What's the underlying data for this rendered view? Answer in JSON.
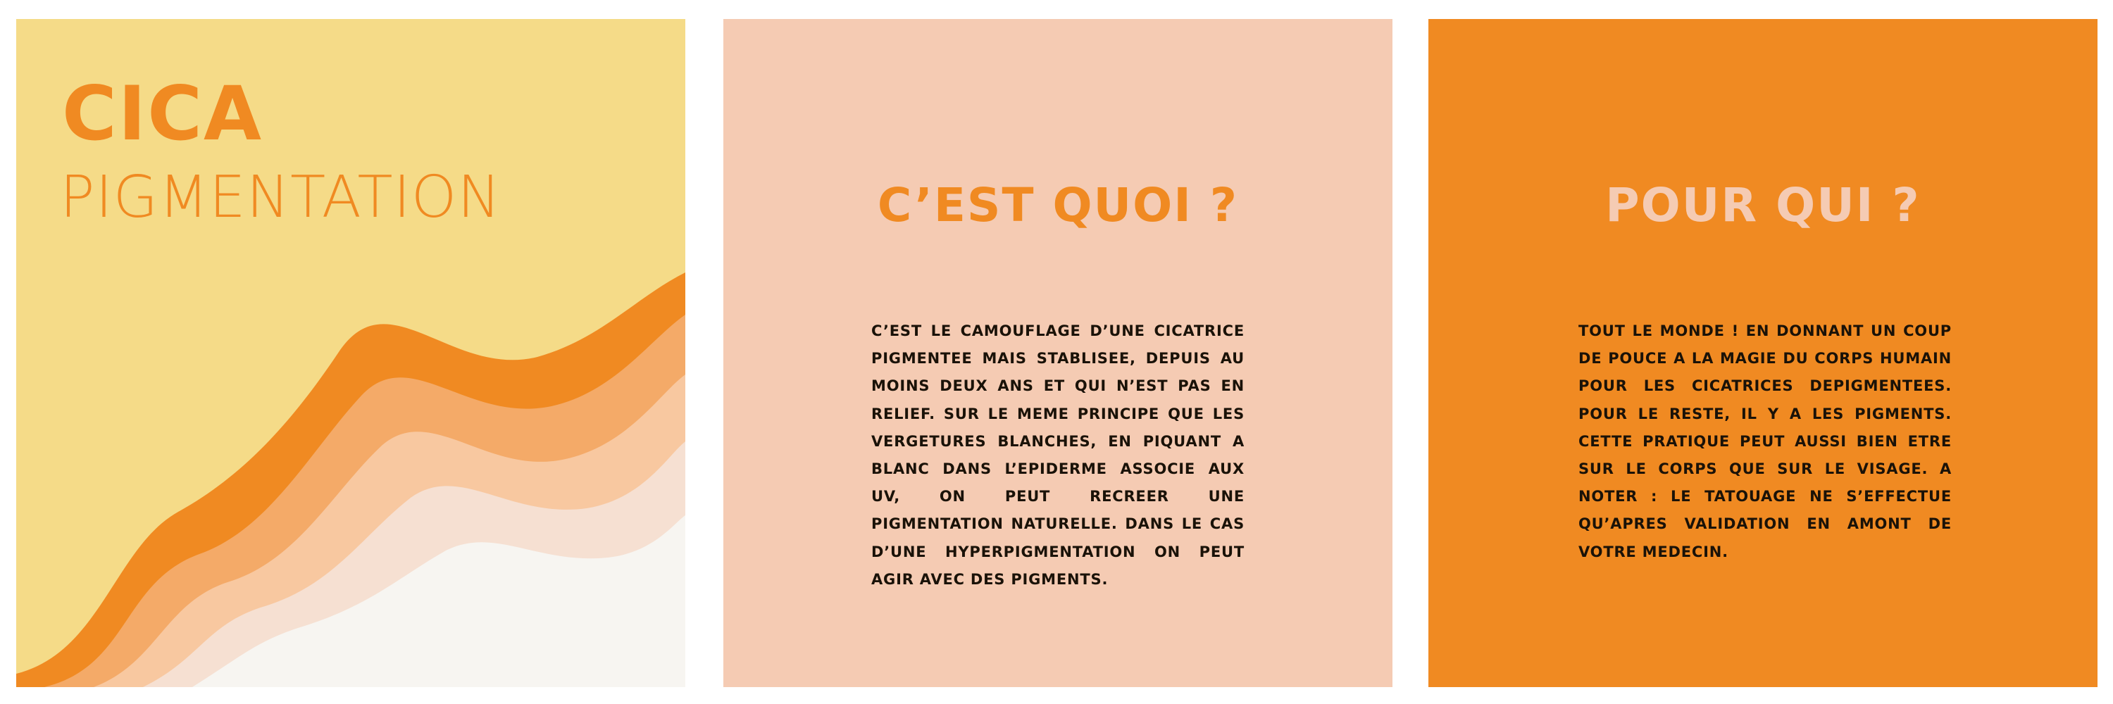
{
  "panels": [
    {
      "title": "CICA",
      "subtitle": "PIGMENTATION",
      "colors": {
        "background": "#f5db88",
        "text": "#f08a22"
      },
      "waves": [
        "#f08a22",
        "#f4aa68",
        "#f8c8a0",
        "#f6e0d2",
        "#f7f5f1"
      ]
    },
    {
      "heading": "C’EST QUOI ?",
      "body": "C’EST LE CAMOUFLAGE D’UNE CICATRICE PIGMENTEE MAIS STABLISEE, DEPUIS AU MOINS DEUX ANS ET QUI N’EST PAS EN RELIEF. SUR LE MEME PRINCIPE QUE LES VERGETURES BLANCHES, EN PIQUANT A BLANC DANS L’EPIDERME ASSOCIE AUX UV, ON PEUT RECREER UNE PIGMENTATION NATURELLE. DANS LE CAS D’UNE HYPERPIGMENTATION ON PEUT AGIR AVEC DES PIGMENTS.",
      "colors": {
        "background": "#f5cbb3",
        "heading": "#f08a22",
        "text": "#1a1208"
      }
    },
    {
      "heading": "POUR QUI ?",
      "body": "TOUT LE MONDE ! EN DONNANT UN COUP DE POUCE A LA MAGIE DU CORPS HUMAIN POUR LES CICATRICES DEPIGMENTEES. POUR LE RESTE, IL Y A LES PIGMENTS. CETTE PRATIQUE PEUT AUSSI BIEN ETRE SUR LE CORPS QUE SUR LE VISAGE. A NOTER : LE TATOUAGE NE S’EFFECTUE QU’APRES VALIDATION EN AMONT DE VOTRE MEDECIN.",
      "colors": {
        "background": "#f08a22",
        "heading": "#f5cbb3",
        "text": "#1a1208"
      }
    }
  ]
}
